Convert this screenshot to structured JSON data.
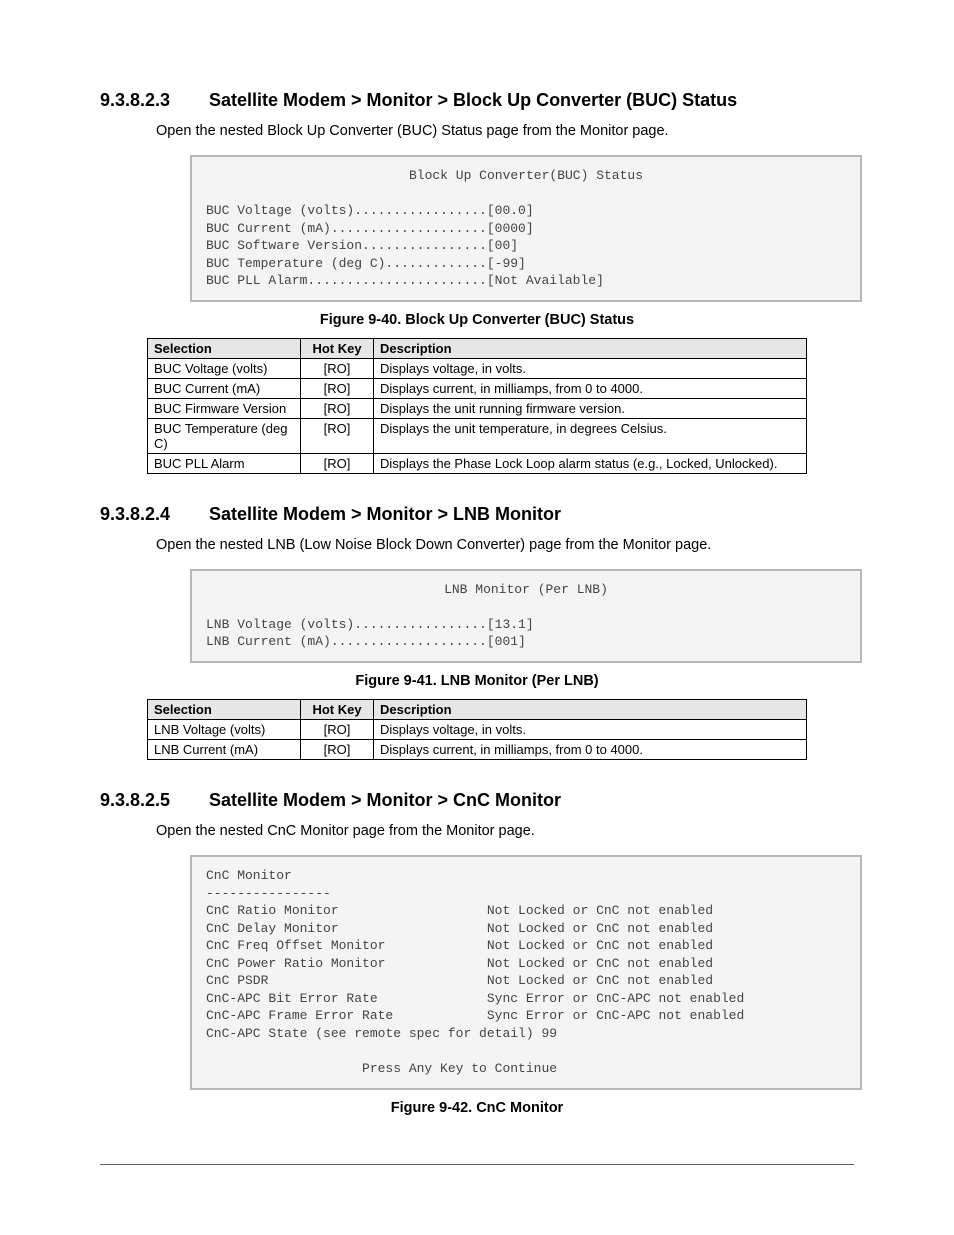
{
  "s1": {
    "num": "9.3.8.2.3",
    "title": "Satellite Modem > Monitor > Block Up Converter (BUC) Status",
    "intro": "Open the nested Block Up Converter (BUC) Status page from the Monitor page.",
    "term_title": "Block Up Converter(BUC) Status",
    "term_lines": [
      "BUC Voltage (volts).................[00.0]",
      "BUC Current (mA)....................[0000]",
      "BUC Software Version................[00]",
      "BUC Temperature (deg C).............[-99]",
      "BUC PLL Alarm.......................[Not Available]"
    ],
    "figcap": "Figure 9-40. Block Up Converter (BUC) Status",
    "th": {
      "sel": "Selection",
      "hk": "Hot Key",
      "desc": "Description"
    },
    "rows": [
      {
        "sel": "BUC Voltage (volts)",
        "hk": "[RO]",
        "desc": "Displays voltage, in volts."
      },
      {
        "sel": "BUC Current (mA)",
        "hk": "[RO]",
        "desc": "Displays current, in milliamps, from 0 to 4000."
      },
      {
        "sel": "BUC Firmware Version",
        "hk": "[RO]",
        "desc": "Displays the unit running firmware version."
      },
      {
        "sel": "BUC Temperature (deg C)",
        "hk": "[RO]",
        "desc": "Displays the unit temperature, in degrees Celsius."
      },
      {
        "sel": "BUC PLL Alarm",
        "hk": "[RO]",
        "desc": "Displays the Phase Lock Loop alarm status (e.g., Locked, Unlocked)."
      }
    ]
  },
  "s2": {
    "num": "9.3.8.2.4",
    "title": "Satellite Modem > Monitor > LNB Monitor",
    "intro": "Open the nested LNB (Low Noise Block Down Converter) page from the Monitor page.",
    "term_title": "LNB Monitor (Per LNB)",
    "term_lines": [
      "LNB Voltage (volts).................[13.1]",
      "LNB Current (mA)....................[001]"
    ],
    "figcap": "Figure 9-41. LNB Monitor (Per LNB)",
    "th": {
      "sel": "Selection",
      "hk": "Hot Key",
      "desc": "Description"
    },
    "rows": [
      {
        "sel": "LNB Voltage (volts)",
        "hk": "[RO]",
        "desc": "Displays voltage, in volts."
      },
      {
        "sel": "LNB Current (mA)",
        "hk": "[RO]",
        "desc": "Displays current, in milliamps, from 0 to 4000."
      }
    ]
  },
  "s3": {
    "num": "9.3.8.2.5",
    "title": "Satellite Modem > Monitor > CnC Monitor",
    "intro": "Open the nested CnC Monitor page from the Monitor page.",
    "term_lines": [
      "CnC Monitor",
      "----------------",
      "CnC Ratio Monitor                   Not Locked or CnC not enabled",
      "CnC Delay Monitor                   Not Locked or CnC not enabled",
      "CnC Freq Offset Monitor             Not Locked or CnC not enabled",
      "CnC Power Ratio Monitor             Not Locked or CnC not enabled",
      "CnC PSDR                            Not Locked or CnC not enabled",
      "CnC-APC Bit Error Rate              Sync Error or CnC-APC not enabled",
      "CnC-APC Frame Error Rate            Sync Error or CnC-APC not enabled",
      "CnC-APC State (see remote spec for detail) 99",
      "",
      "                    Press Any Key to Continue"
    ],
    "figcap": "Figure 9-42. CnC Monitor"
  }
}
